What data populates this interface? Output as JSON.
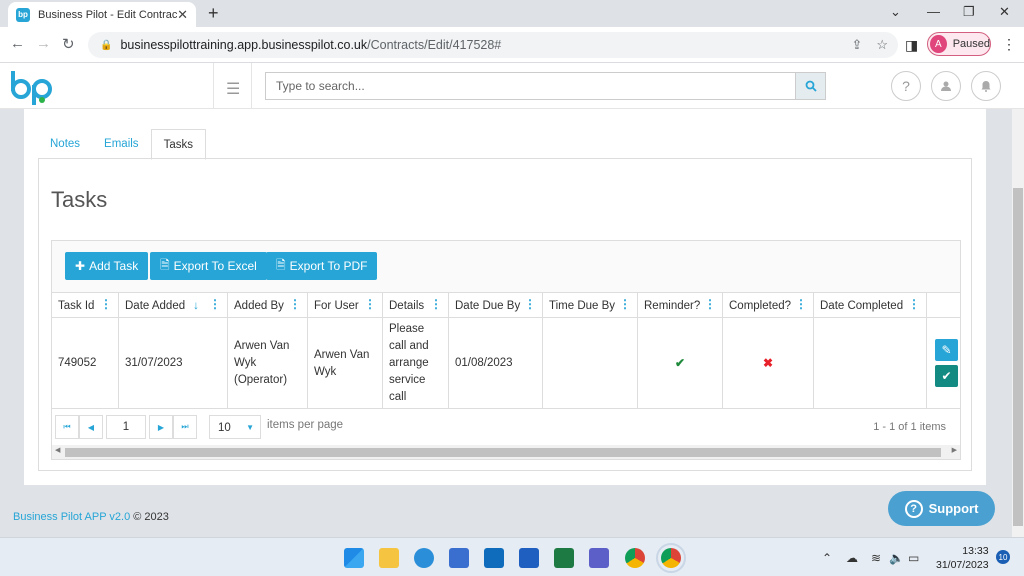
{
  "browser": {
    "tab_title": "Business Pilot - Edit Contract",
    "favicon_text": "bp",
    "url_host": "businesspilottraining.app.businesspilot.co.uk",
    "url_path": "/Contracts/Edit/417528#",
    "profile_initial": "A",
    "profile_status": "Paused"
  },
  "header": {
    "search_placeholder": "Type to search..."
  },
  "page": {
    "tabs": [
      "Notes",
      "Emails",
      "Tasks"
    ],
    "active_tab": "Tasks",
    "title": "Tasks"
  },
  "toolbar": {
    "add_task": "Add Task",
    "export_excel": "Export To Excel",
    "export_pdf": "Export To PDF"
  },
  "table": {
    "columns": [
      "Task Id",
      "Date Added",
      "Added By",
      "For User",
      "Details",
      "Date Due By",
      "Time Due By",
      "Reminder?",
      "Completed?",
      "Date Completed"
    ],
    "rows": [
      {
        "task_id": "749052",
        "date_added": "31/07/2023",
        "added_by": "Arwen Van Wyk (Operator)",
        "for_user": "Arwen Van Wyk",
        "details": "Please call and arrange service call",
        "date_due_by": "01/08/2023",
        "time_due_by": "",
        "reminder": true,
        "completed": false,
        "date_completed": ""
      }
    ]
  },
  "pager": {
    "page": "1",
    "page_size": "10",
    "items_per_page_label": "items per page",
    "info": "1 - 1 of 1 items"
  },
  "footer": {
    "brand": "Business Pilot APP v2.0",
    "copyright": "© 2023"
  },
  "support_label": "Support",
  "taskbar": {
    "time": "13:33",
    "date": "31/07/2023",
    "notifications": "10"
  },
  "colors": {
    "accent": "#26a5d6",
    "success": "#138a82",
    "danger": "#e8202a"
  }
}
